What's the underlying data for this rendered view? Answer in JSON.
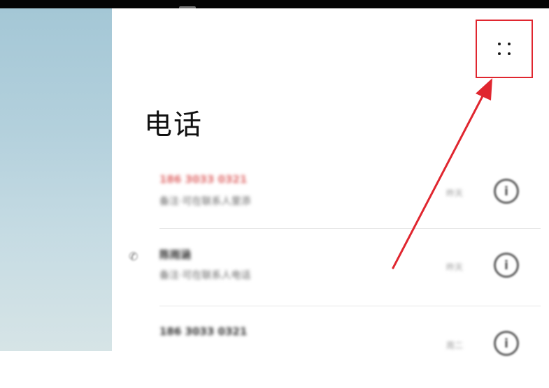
{
  "title": "电话",
  "calls": [
    {
      "name": "186 3033 0321",
      "sub": "备注·可在联系人里添",
      "time": "昨天",
      "missed": true
    },
    {
      "name": "陈雨涵",
      "sub": "备注·可在联系人电话",
      "time": "昨天",
      "missed": false
    },
    {
      "name": "186 3033 0321",
      "sub": "",
      "time": "周二",
      "missed": false
    }
  ],
  "icons": {
    "more": "more-dots-icon",
    "call": "phone-call-icon",
    "info": "info-icon"
  },
  "colors": {
    "highlight": "#e0262f",
    "missed": "#e06b6b",
    "sidebar_top": "#a4c7d6"
  }
}
